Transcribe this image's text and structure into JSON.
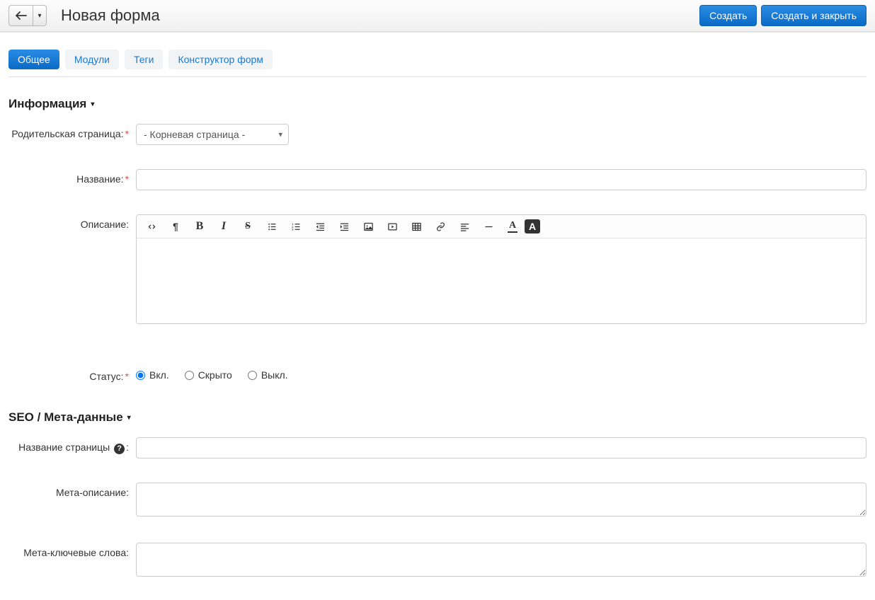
{
  "header": {
    "title": "Новая форма",
    "create_label": "Создать",
    "create_close_label": "Создать и закрыть"
  },
  "tabs": [
    {
      "label": "Общее",
      "active": true
    },
    {
      "label": "Модули",
      "active": false
    },
    {
      "label": "Теги",
      "active": false
    },
    {
      "label": "Конструктор форм",
      "active": false
    }
  ],
  "sections": {
    "info": {
      "title": "Информация",
      "fields": {
        "parent": {
          "label": "Родительская страница:",
          "required": true,
          "value": "- Корневая страница -"
        },
        "name": {
          "label": "Название:",
          "required": true,
          "value": ""
        },
        "description": {
          "label": "Описание:"
        },
        "status": {
          "label": "Статус:",
          "required": true,
          "options": [
            "Вкл.",
            "Скрыто",
            "Выкл."
          ],
          "selected": 0
        }
      }
    },
    "seo": {
      "title": "SEO / Мета-данные",
      "fields": {
        "page_title": {
          "label_prefix": "Название страницы",
          "label_suffix": ":",
          "value": ""
        },
        "meta_description": {
          "label": "Мета-описание:",
          "value": ""
        },
        "meta_keywords": {
          "label": "Мета-ключевые слова:",
          "value": ""
        }
      }
    }
  },
  "icons": {
    "back_arrow": "↩",
    "caret_down": "▾"
  }
}
